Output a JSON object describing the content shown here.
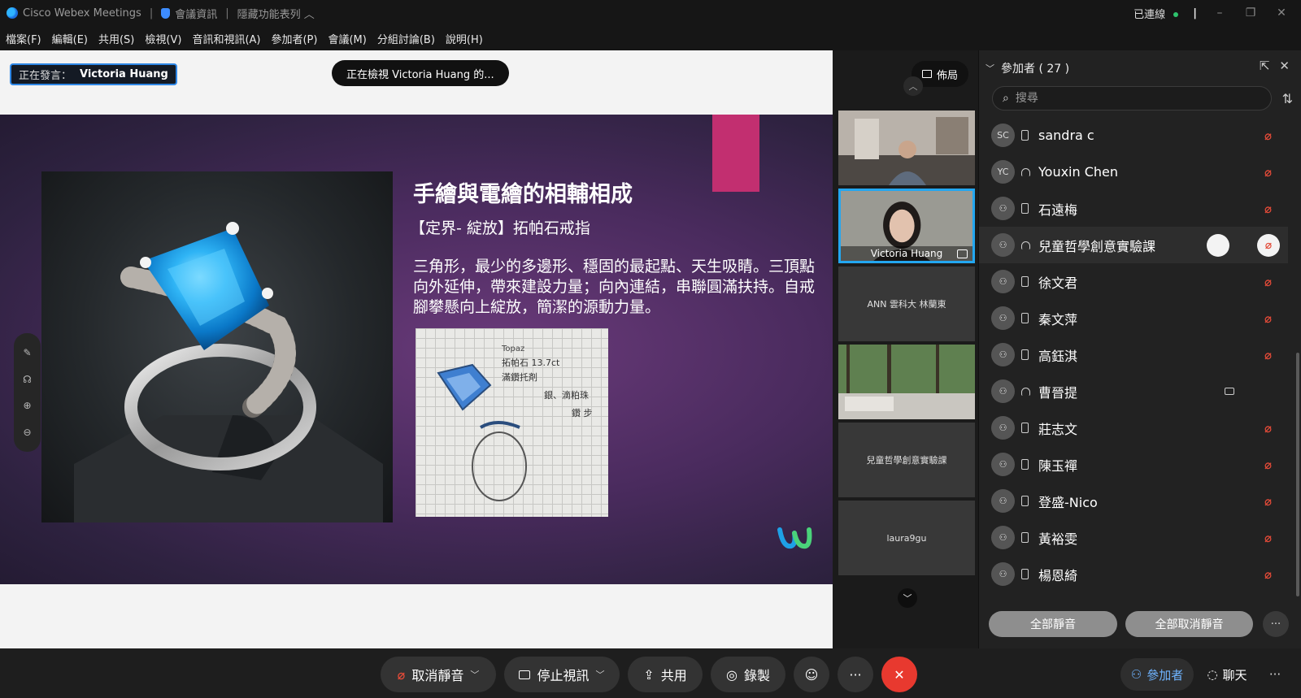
{
  "titlebar": {
    "app_name": "Cisco Webex Meetings",
    "meeting_info": "會議資訊",
    "hide_menu": "隱藏功能表列",
    "status": "已連線"
  },
  "menu": [
    "檔案(F)",
    "編輯(E)",
    "共用(S)",
    "檢視(V)",
    "音訊和視訊(A)",
    "參加者(P)",
    "會議(M)",
    "分組討論(B)",
    "說明(H)"
  ],
  "stage": {
    "speaking_label": "正在發言：",
    "speaking_name": "Victoria Huang",
    "viewing_text": "正在檢視 Victoria Huang 的...",
    "slide": {
      "title": "手繪與電繪的相輔相成",
      "subtitle": "【定界- 綻放】拓帕石戒指",
      "body": "三角形，最少的多邊形、穩固的最起點、天生吸睛。三頂點向外延伸，帶來建設力量；向內連結，串聯圓滿扶持。自戒腳攀懸向上綻放，簡潔的源動力量。",
      "sketch_notes": [
        "Topaz",
        "拓帕石 13.7ct",
        "滿鑽托剤",
        "銀、滴粕珠",
        "鑽 步"
      ]
    }
  },
  "filmstrip": {
    "layout_label": "佈局",
    "tiles": [
      {
        "name": ""
      },
      {
        "name": "Victoria Huang"
      },
      {
        "name": "ANN 雲科大 林蘭東"
      },
      {
        "name": ""
      },
      {
        "name": "兒童哲學創意實驗課"
      },
      {
        "name": "laura9gu"
      }
    ]
  },
  "participants": {
    "header": "參加者 ( 27 )",
    "search_placeholder": "搜尋",
    "list": [
      {
        "initials": "SC",
        "name": "sandra c",
        "device": "phone",
        "muted": true
      },
      {
        "initials": "YC",
        "name": "Youxin Chen",
        "device": "headset",
        "muted": true
      },
      {
        "initials": "",
        "name": "石遠梅",
        "device": "phone",
        "muted": true
      },
      {
        "initials": "",
        "name": "兒童哲學創意實驗課",
        "device": "headset",
        "muted": true
      },
      {
        "initials": "",
        "name": "徐文君",
        "device": "phone",
        "muted": true
      },
      {
        "initials": "",
        "name": "秦文萍",
        "device": "phone",
        "muted": true
      },
      {
        "initials": "",
        "name": "高鈺淇",
        "device": "phone",
        "muted": true
      },
      {
        "initials": "",
        "name": "曹晉提",
        "device": "headset",
        "muted": false
      },
      {
        "initials": "",
        "name": "莊志文",
        "device": "phone",
        "muted": true
      },
      {
        "initials": "",
        "name": "陳玉禪",
        "device": "phone",
        "muted": true
      },
      {
        "initials": "",
        "name": "登盛-Nico",
        "device": "phone",
        "muted": true
      },
      {
        "initials": "",
        "name": "黃裕雯",
        "device": "phone",
        "muted": true
      },
      {
        "initials": "",
        "name": "楊恩綺",
        "device": "phone",
        "muted": true
      }
    ],
    "mute_all": "全部靜音",
    "unmute_all": "全部取消靜音"
  },
  "controls": {
    "unmute": "取消靜音",
    "stop_video": "停止視訊",
    "share": "共用",
    "record": "錄製",
    "participants_tab": "參加者",
    "chat_tab": "聊天"
  },
  "colors": {
    "accent": "#23a7f0",
    "mute_red": "#e24a38",
    "end_red": "#e8392f",
    "slide_pink": "#c22f70"
  }
}
